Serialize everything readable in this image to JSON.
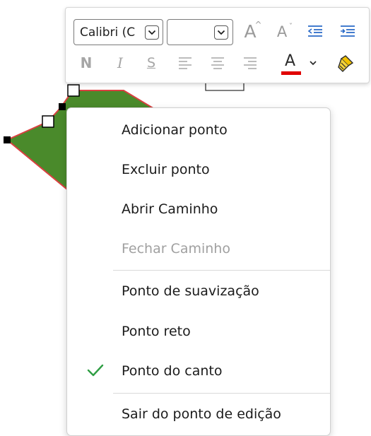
{
  "mini_toolbar": {
    "font_name_value": "Calibri (C",
    "font_size_value": "",
    "row1_icons": [
      "increase-font-size-icon",
      "decrease-font-size-icon",
      "decrease-indent-icon",
      "increase-indent-icon"
    ],
    "row2_icons": [
      "bold-icon",
      "italic-icon",
      "strikethrough-icon",
      "align-left-icon",
      "align-center-icon",
      "align-right-icon",
      "font-color-icon",
      "font-color-dropdown-icon",
      "format-painter-icon"
    ],
    "bold_glyph": "N",
    "italic_glyph": "I",
    "strike_glyph": "S",
    "font_color_glyph": "A",
    "grow_glyph": "A",
    "shrink_glyph": "A",
    "font_color_hex": "#e00000"
  },
  "shape": {
    "fill_color": "#4a8a2b",
    "outline_color": "#d94040"
  },
  "context_menu": {
    "items": [
      {
        "label": "Adicionar ponto",
        "enabled": true,
        "checked": false
      },
      {
        "label": "Excluir ponto",
        "enabled": true,
        "checked": false
      },
      {
        "label": "Abrir Caminho",
        "enabled": true,
        "checked": false
      },
      {
        "label": "Fechar Caminho",
        "enabled": false,
        "checked": false
      },
      {
        "label": "Ponto de suavização",
        "enabled": true,
        "checked": false
      },
      {
        "label": "Ponto reto",
        "enabled": true,
        "checked": false
      },
      {
        "label": "Ponto do canto",
        "enabled": true,
        "checked": true
      },
      {
        "label": "Sair do ponto de edição",
        "enabled": true,
        "checked": false
      }
    ],
    "check_color": "#2f9e44"
  }
}
